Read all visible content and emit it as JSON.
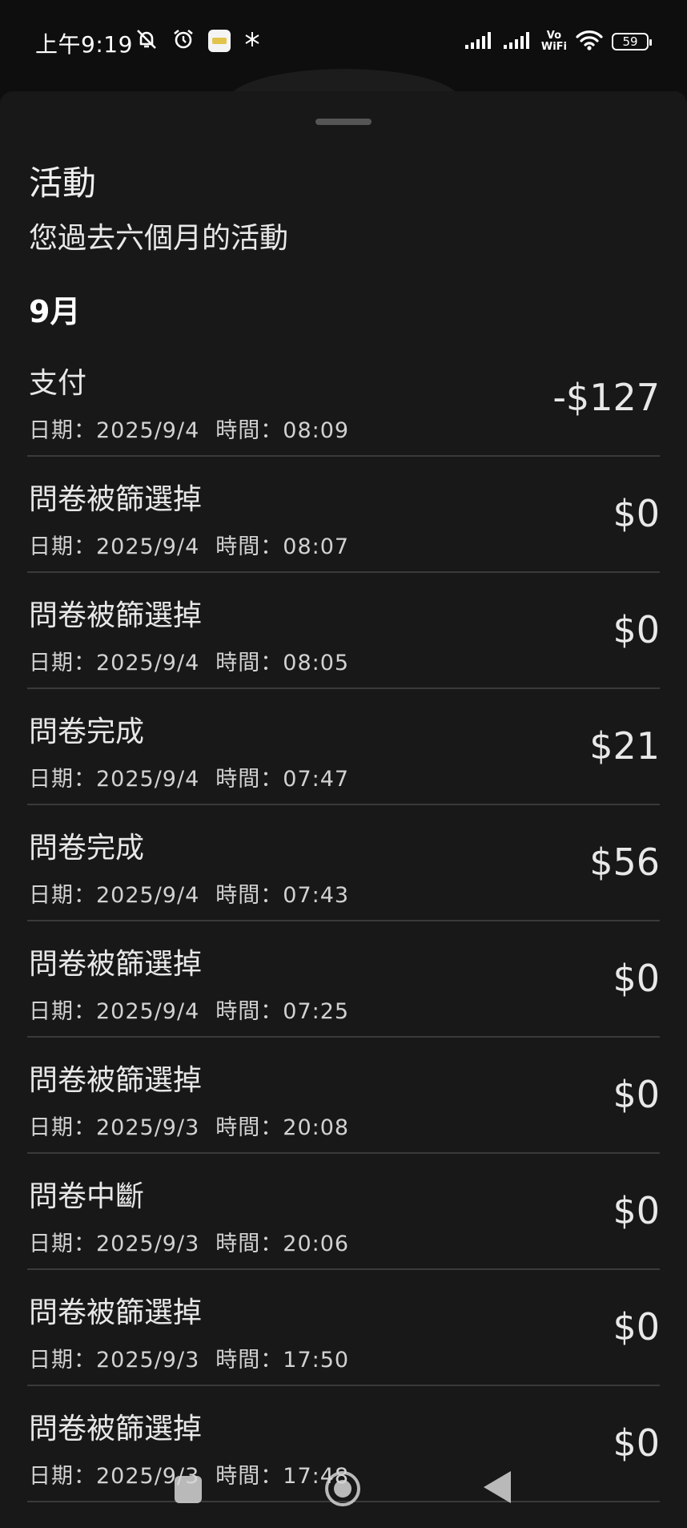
{
  "status_bar": {
    "time": "上午9:19",
    "battery": "59",
    "vo_label": "Vo",
    "wifi_label": "WiFi",
    "icons": [
      "mute-bell-icon",
      "alarm-icon",
      "app-notification-icon",
      "snowflake-icon",
      "signal-icon",
      "signal-icon",
      "vowifi-icon",
      "wifi-icon",
      "battery-icon"
    ]
  },
  "sheet": {
    "title": "活動",
    "subtitle": "您過去六個月的活動",
    "month": "9月"
  },
  "meta_labels": {
    "date_prefix": "日期：",
    "time_prefix": "時間："
  },
  "activities": [
    {
      "title": "支付",
      "date": "2025/9/4",
      "time": "08:09",
      "amount": "-$127"
    },
    {
      "title": "問卷被篩選掉",
      "date": "2025/9/4",
      "time": "08:07",
      "amount": "$0"
    },
    {
      "title": "問卷被篩選掉",
      "date": "2025/9/4",
      "time": "08:05",
      "amount": "$0"
    },
    {
      "title": "問卷完成",
      "date": "2025/9/4",
      "time": "07:47",
      "amount": "$21"
    },
    {
      "title": "問卷完成",
      "date": "2025/9/4",
      "time": "07:43",
      "amount": "$56"
    },
    {
      "title": "問卷被篩選掉",
      "date": "2025/9/4",
      "time": "07:25",
      "amount": "$0"
    },
    {
      "title": "問卷被篩選掉",
      "date": "2025/9/3",
      "time": "20:08",
      "amount": "$0"
    },
    {
      "title": "問卷中斷",
      "date": "2025/9/3",
      "time": "20:06",
      "amount": "$0"
    },
    {
      "title": "問卷被篩選掉",
      "date": "2025/9/3",
      "time": "17:50",
      "amount": "$0"
    },
    {
      "title": "問卷被篩選掉",
      "date": "2025/9/3",
      "time": "17:48",
      "amount": "$0"
    }
  ],
  "nav": {
    "icons": [
      "recents-icon",
      "home-icon",
      "back-icon"
    ]
  }
}
